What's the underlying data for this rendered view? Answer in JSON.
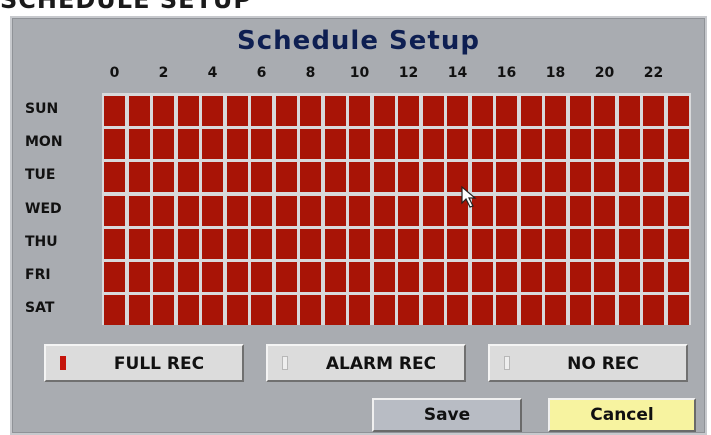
{
  "window": {
    "partial_heading": "SCHEDULE SETUP"
  },
  "dialog": {
    "title": "Schedule Setup"
  },
  "hours": [
    "0",
    "2",
    "4",
    "6",
    "8",
    "10",
    "12",
    "14",
    "16",
    "18",
    "20",
    "22"
  ],
  "days": [
    "SUN",
    "MON",
    "TUE",
    "WED",
    "THU",
    "FRI",
    "SAT"
  ],
  "slots_per_day": 24,
  "schedule": {
    "SUN": [
      "F",
      "F",
      "F",
      "F",
      "F",
      "F",
      "F",
      "F",
      "F",
      "F",
      "F",
      "F",
      "F",
      "F",
      "F",
      "F",
      "F",
      "F",
      "F",
      "F",
      "F",
      "F",
      "F",
      "F"
    ],
    "MON": [
      "F",
      "F",
      "F",
      "F",
      "F",
      "F",
      "F",
      "F",
      "F",
      "F",
      "F",
      "F",
      "F",
      "F",
      "F",
      "F",
      "F",
      "F",
      "F",
      "F",
      "F",
      "F",
      "F",
      "F"
    ],
    "TUE": [
      "F",
      "F",
      "F",
      "F",
      "F",
      "F",
      "F",
      "F",
      "F",
      "F",
      "F",
      "F",
      "F",
      "F",
      "F",
      "F",
      "F",
      "F",
      "F",
      "F",
      "F",
      "F",
      "F",
      "F"
    ],
    "WED": [
      "F",
      "F",
      "F",
      "F",
      "F",
      "F",
      "F",
      "F",
      "F",
      "F",
      "F",
      "F",
      "F",
      "F",
      "F",
      "F",
      "F",
      "F",
      "F",
      "F",
      "F",
      "F",
      "F",
      "F"
    ],
    "THU": [
      "F",
      "F",
      "F",
      "F",
      "F",
      "F",
      "F",
      "F",
      "F",
      "F",
      "F",
      "F",
      "F",
      "F",
      "F",
      "F",
      "F",
      "F",
      "F",
      "F",
      "F",
      "F",
      "F",
      "F"
    ],
    "FRI": [
      "F",
      "F",
      "F",
      "F",
      "F",
      "F",
      "F",
      "F",
      "F",
      "F",
      "F",
      "F",
      "F",
      "F",
      "F",
      "F",
      "F",
      "F",
      "F",
      "F",
      "F",
      "F",
      "F",
      "F"
    ],
    "SAT": [
      "F",
      "F",
      "F",
      "F",
      "F",
      "F",
      "F",
      "F",
      "F",
      "F",
      "F",
      "F",
      "F",
      "F",
      "F",
      "F",
      "F",
      "F",
      "F",
      "F",
      "F",
      "F",
      "F",
      "F"
    ]
  },
  "modes": [
    {
      "label": "FULL REC",
      "swatch": "full",
      "color": "#c5150c"
    },
    {
      "label": "ALARM REC",
      "swatch": "alarm",
      "color": "#eeeeee"
    },
    {
      "label": "NO REC",
      "swatch": "none",
      "color": "#eeeeee"
    }
  ],
  "actions": {
    "save_label": "Save",
    "cancel_label": "Cancel"
  },
  "colors": {
    "full_rec": "#a81406",
    "panel": "#a9acb1",
    "title": "#0e1f52",
    "cancel_bg": "#f7f3a0"
  },
  "icons": {
    "pointer": "mouse-pointer-icon"
  }
}
